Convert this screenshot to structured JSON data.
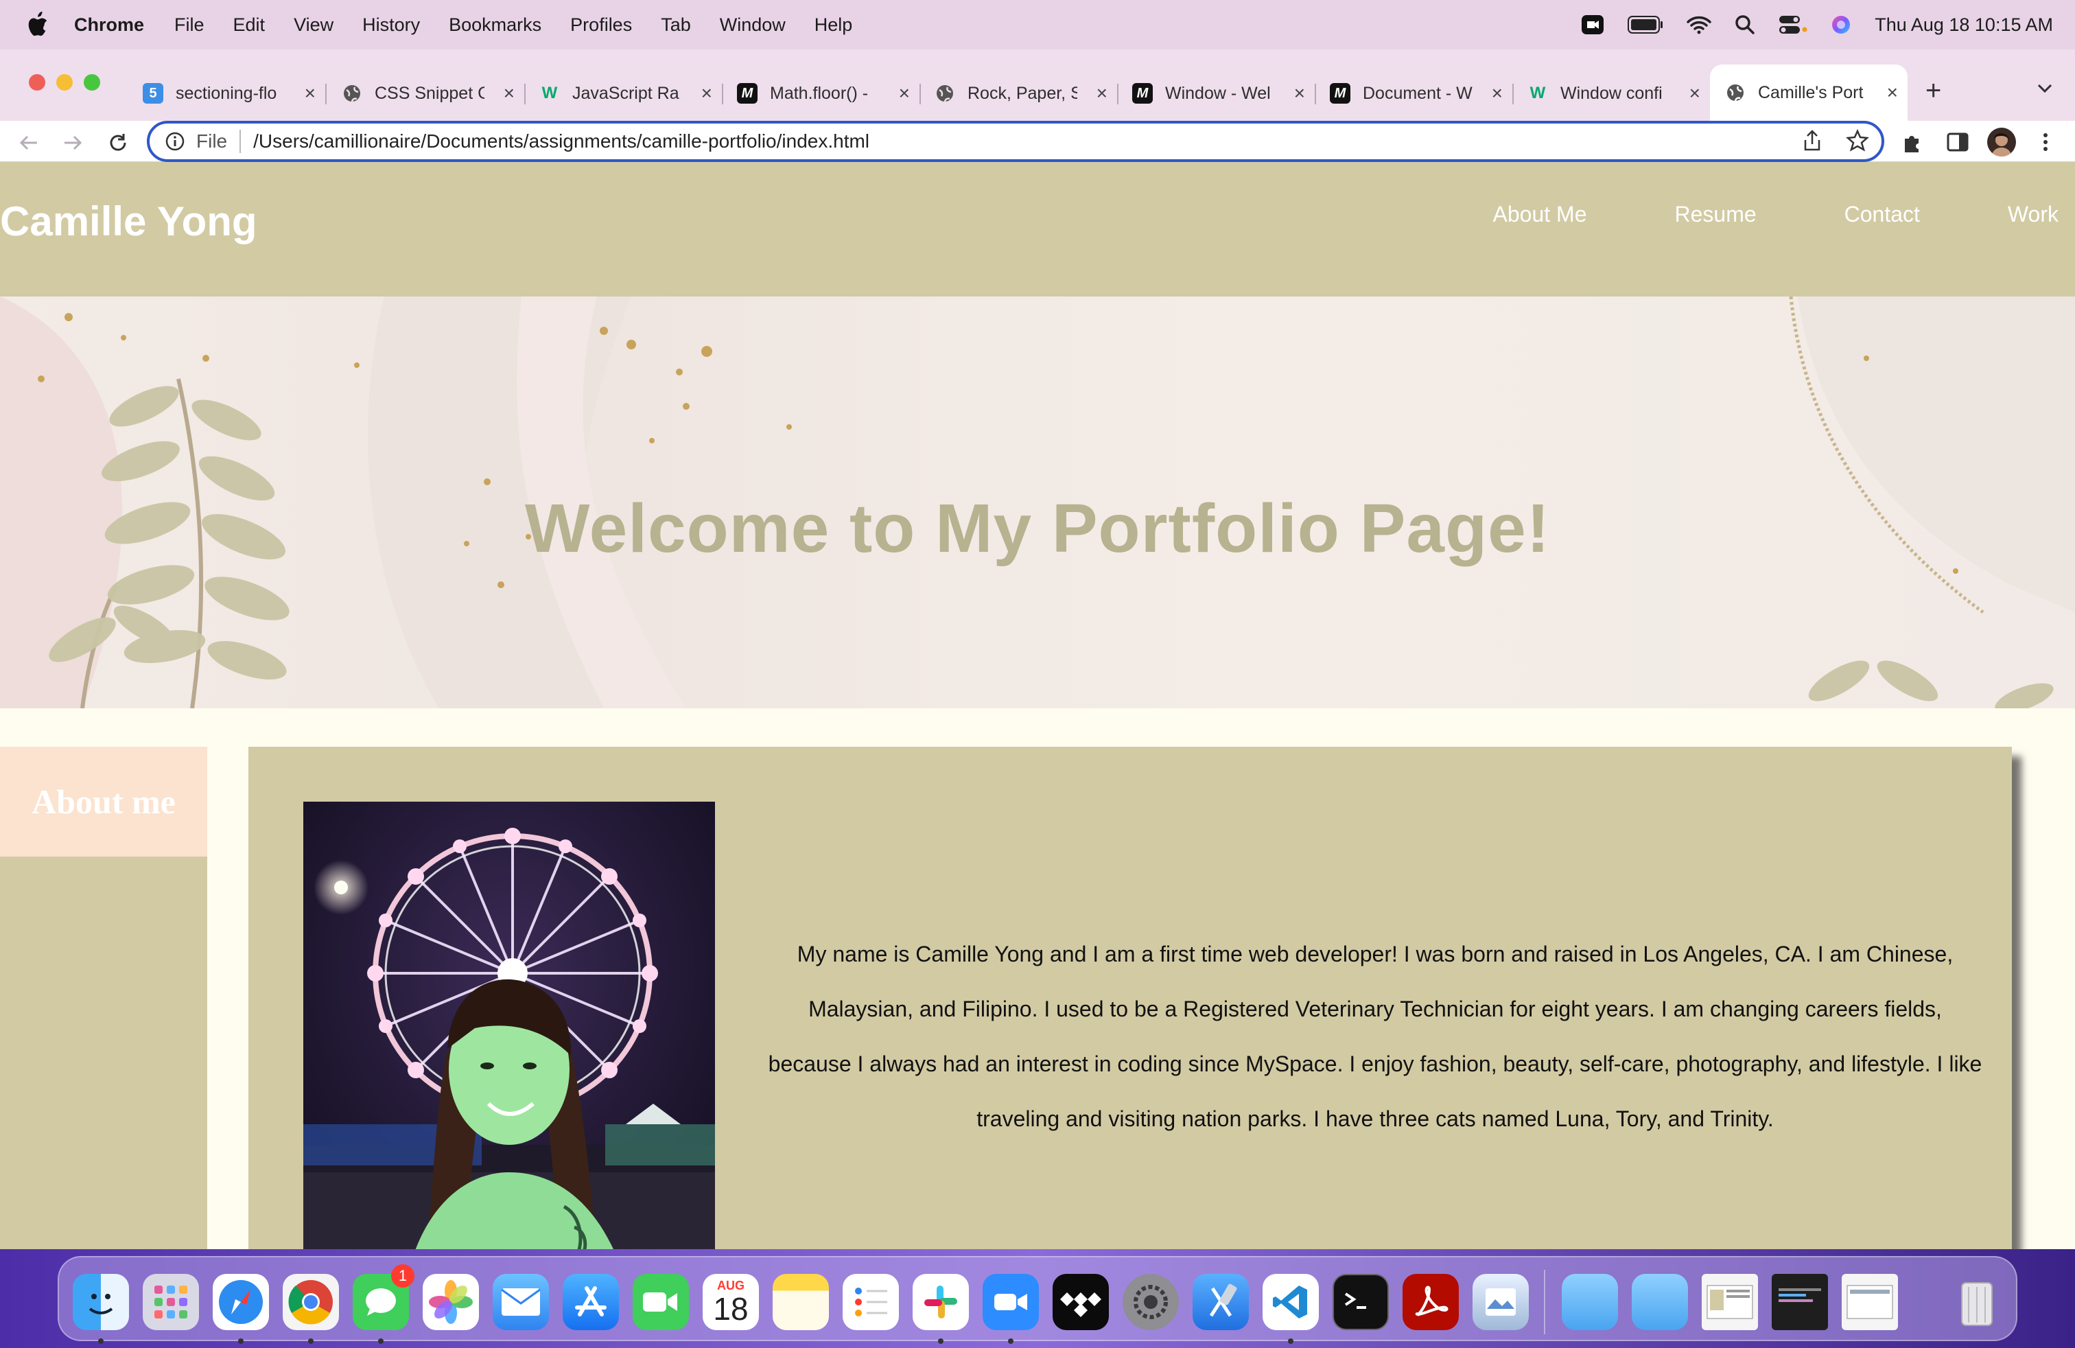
{
  "menubar": {
    "app": "Chrome",
    "items": [
      "File",
      "Edit",
      "View",
      "History",
      "Bookmarks",
      "Profiles",
      "Tab",
      "Window",
      "Help"
    ],
    "clock": "Thu Aug 18  10:15 AM"
  },
  "browser": {
    "tabs": [
      {
        "title": "sectioning-flo",
        "favicon": "5-icon",
        "color": "#3d8ee6"
      },
      {
        "title": "CSS Snippet C",
        "favicon": "globe-icon",
        "color": "#555555"
      },
      {
        "title": "JavaScript Ra",
        "favicon": "w3-icon",
        "color": "#04aa6d"
      },
      {
        "title": "Math.floor() -",
        "favicon": "mdn-icon",
        "color": "#111111"
      },
      {
        "title": "Rock, Paper, S",
        "favicon": "globe-icon",
        "color": "#555555"
      },
      {
        "title": "Window - Wel",
        "favicon": "mdn-icon",
        "color": "#111111"
      },
      {
        "title": "Document - W",
        "favicon": "mdn-icon",
        "color": "#111111"
      },
      {
        "title": "Window confi",
        "favicon": "w3-icon",
        "color": "#04aa6d"
      },
      {
        "title": "Camille's Port",
        "favicon": "globe-icon",
        "color": "#555555",
        "active": true
      }
    ],
    "scheme": "File",
    "url": "/Users/camillionaire/Documents/assignments/camille-portfolio/index.html"
  },
  "site": {
    "brand": "Camille Yong",
    "nav": [
      "About Me",
      "Resume",
      "Contact",
      "Work"
    ],
    "hero_title": "Welcome to My Portfolio Page!",
    "about_heading": "About me",
    "bio": "My name is Camille Yong and I am a first time web developer! I was born and raised in Los Angeles, CA. I am Chinese, Malaysian, and Filipino. I used to be a Registered Veterinary Technician for eight years. I am changing careers fields, because I always had an interest in coding since MySpace. I enjoy fashion, beauty, self-care, photography, and lifestyle. I like traveling and visiting nation parks. I have three cats named Luna, Tory, and Trinity.",
    "colors": {
      "header": "#d2caa3",
      "hero_title": "#b7b28f",
      "about_tab": "#fbe3cf",
      "page_bg": "#fffdf0"
    }
  },
  "dock": {
    "badge": "1",
    "calendar_month": "AUG",
    "calendar_day": "18",
    "apps": [
      "finder-icon",
      "launchpad-icon",
      "safari-icon",
      "chrome-icon",
      "messages-icon",
      "photos-icon",
      "mail-icon",
      "app-store-icon",
      "facetime-icon",
      "calendar-icon",
      "notes-icon",
      "reminders-icon",
      "slack-icon",
      "zoom-icon",
      "tidal-icon",
      "system-preferences-icon",
      "xcode-icon",
      "vscode-icon",
      "terminal-icon",
      "acrobat-icon",
      "preview-icon",
      "folder-icon",
      "folder-icon",
      "window-thumbnail-icon",
      "window-thumbnail-icon",
      "window-thumbnail-icon",
      "trash-icon"
    ]
  }
}
